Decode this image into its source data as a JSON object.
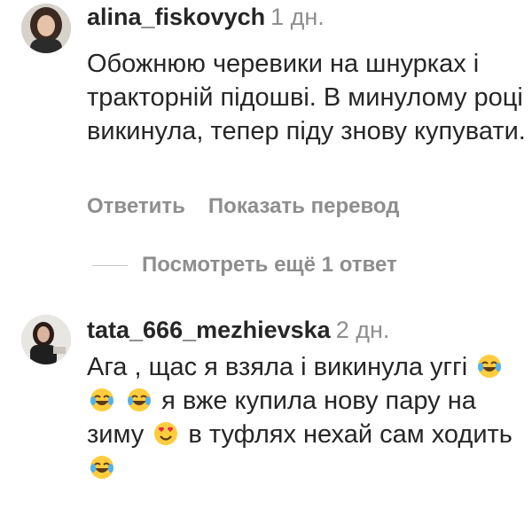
{
  "comments": [
    {
      "username": "alina_fiskovych",
      "time": "1 дн.",
      "text": "Обожнюю черевики на шнурках і тракторній підошві. В минулому році викинула, тепер піду знову купувати.",
      "reply_label": "Ответить",
      "translate_label": "Показать перевод"
    },
    {
      "username": "tata_666_mezhievska",
      "time": "2 дн.",
      "text_parts": [
        "Ага , щас я взяла і викинула уггі",
        "я вже купила нову пару на зиму",
        "в туфлях нехай сам ходить"
      ]
    }
  ],
  "view_replies_label": "Посмотреть ещё 1 ответ",
  "emoji": {
    "laugh": "face-with-tears-of-joy-icon",
    "heart_eyes": "smiling-face-with-heart-eyes-icon"
  }
}
